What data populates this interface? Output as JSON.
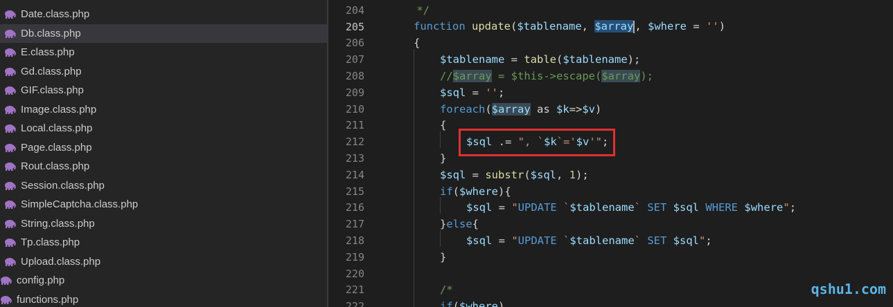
{
  "sidebar": {
    "files": [
      {
        "name": "Date.class.php",
        "type": "sub"
      },
      {
        "name": "Db.class.php",
        "type": "sub",
        "selected": true
      },
      {
        "name": "E.class.php",
        "type": "sub"
      },
      {
        "name": "Gd.class.php",
        "type": "sub"
      },
      {
        "name": "GIF.class.php",
        "type": "sub"
      },
      {
        "name": "Image.class.php",
        "type": "sub"
      },
      {
        "name": "Local.class.php",
        "type": "sub"
      },
      {
        "name": "Page.class.php",
        "type": "sub"
      },
      {
        "name": "Rout.class.php",
        "type": "sub"
      },
      {
        "name": "Session.class.php",
        "type": "sub"
      },
      {
        "name": "SimpleCaptcha.class.php",
        "type": "sub"
      },
      {
        "name": "String.class.php",
        "type": "sub"
      },
      {
        "name": "Tp.class.php",
        "type": "sub"
      },
      {
        "name": "Upload.class.php",
        "type": "sub"
      },
      {
        "name": "config.php",
        "type": "root"
      },
      {
        "name": "functions.php",
        "type": "root"
      }
    ],
    "icon": "php-elephant-icon",
    "icon_color": "#a074c4"
  },
  "editor": {
    "active_line": "205",
    "line_numbers": [
      "204",
      "205",
      "206",
      "207",
      "208",
      "209",
      "210",
      "211",
      "212",
      "213",
      "214",
      "215",
      "216",
      "217",
      "218",
      "219",
      "220",
      "221",
      "222"
    ],
    "highlight_box_color": "#e03030",
    "highlighted_line": "212"
  },
  "code": {
    "l204": " */",
    "l205_kw": "function",
    "l205_fn": "update",
    "l205_p1": "(",
    "l205_v1": "$tablename",
    "l205_p2": ", ",
    "l205_v2": "$array",
    "l205_p3": ", ",
    "l205_v3": "$where",
    "l205_p4": " = ",
    "l205_s": "''",
    "l205_p5": ")",
    "l206": "{",
    "l207_v1": "$tablename",
    "l207_p1": " = ",
    "l207_fn": "table",
    "l207_p2": "(",
    "l207_v2": "$tablename",
    "l207_p3": ");",
    "l208_c1": "//",
    "l208_c2": "$array",
    "l208_c3": " = $this->escape(",
    "l208_c4": "$array",
    "l208_c5": ");",
    "l209_v": "$sql",
    "l209_p": " = ",
    "l209_s": "''",
    "l209_e": ";",
    "l210_kw": "foreach",
    "l210_p1": "(",
    "l210_v1": "$array",
    "l210_as": " as ",
    "l210_v2": "$k",
    "l210_p2": "=>",
    "l210_v3": "$v",
    "l210_p3": ")",
    "l211": "{",
    "l212_v": "$sql",
    "l212_p": " .= ",
    "l212_s1": "\", `",
    "l212_v2": "$k",
    "l212_s2": "`='",
    "l212_v3": "$v",
    "l212_s3": "'\"",
    "l212_e": ";",
    "l213": "}",
    "l214_v1": "$sql",
    "l214_p1": " = ",
    "l214_fn": "substr",
    "l214_p2": "(",
    "l214_v2": "$sql",
    "l214_p3": ", ",
    "l214_n": "1",
    "l214_p4": ");",
    "l215_kw": "if",
    "l215_p1": "(",
    "l215_v": "$where",
    "l215_p2": "){",
    "l216_v": "$sql",
    "l216_p": " = ",
    "l216_s1": "\"",
    "l216_k1": "UPDATE",
    "l216_s2": " `",
    "l216_v2": "$tablename",
    "l216_s3": "` ",
    "l216_k2": "SET",
    "l216_s4": " ",
    "l216_v3": "$sql",
    "l216_s5": " ",
    "l216_k3": "WHERE",
    "l216_s6": " ",
    "l216_v4": "$where",
    "l216_s7": "\"",
    "l216_e": ";",
    "l217_p1": "}",
    "l217_kw": "else",
    "l217_p2": "{",
    "l218_v": "$sql",
    "l218_p": " = ",
    "l218_s1": "\"",
    "l218_k1": "UPDATE",
    "l218_s2": " `",
    "l218_v2": "$tablename",
    "l218_s3": "` ",
    "l218_k2": "SET",
    "l218_s4": " ",
    "l218_v3": "$sql",
    "l218_s5": "\"",
    "l218_e": ";",
    "l219": "}",
    "l221": "/*",
    "l222_kw": "if",
    "l222_p": "(",
    "l222_v": "$where",
    "l222_p2": ")"
  },
  "watermark": "qshu1.com"
}
